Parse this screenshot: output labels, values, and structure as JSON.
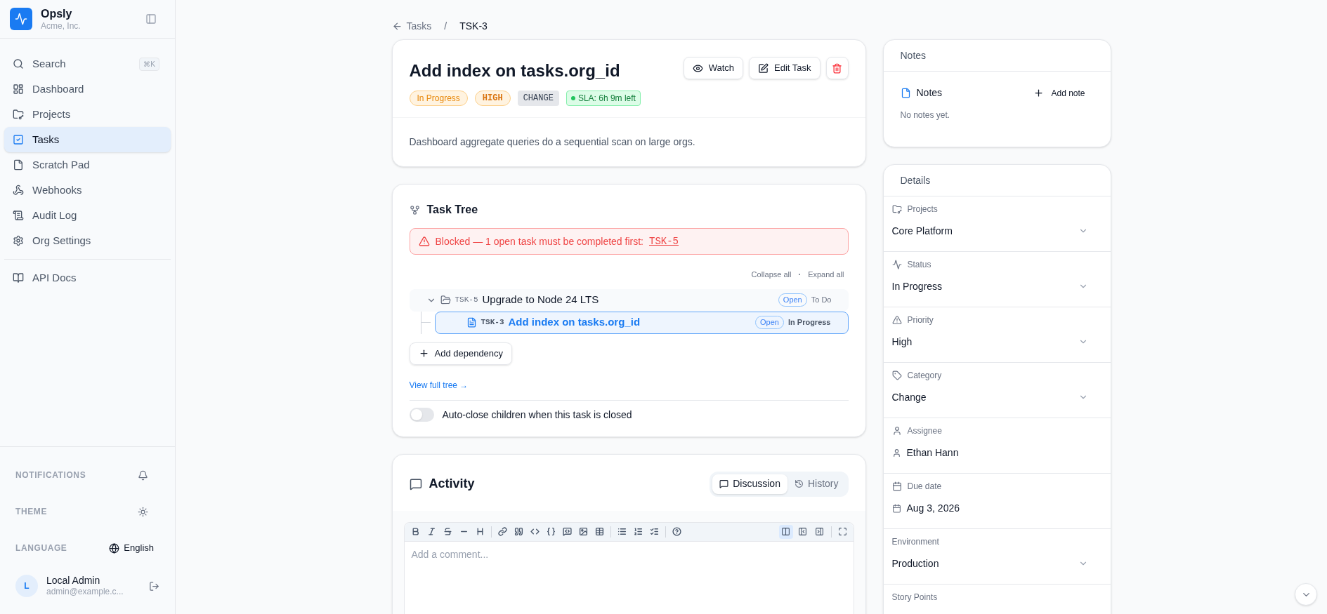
{
  "brand": {
    "name": "Opsly",
    "org": "Acme, Inc."
  },
  "search": {
    "label": "Search",
    "shortcut": "⌘K"
  },
  "nav_groups": [
    {
      "items": [
        {
          "label": "Dashboard",
          "selected": false
        },
        {
          "label": "Projects",
          "selected": false
        },
        {
          "label": "Tasks",
          "selected": true
        },
        {
          "label": "Scratch Pad",
          "selected": false
        },
        {
          "label": "Webhooks",
          "selected": false
        },
        {
          "label": "Audit Log",
          "selected": false
        },
        {
          "label": "Org Settings",
          "selected": false
        }
      ]
    },
    {
      "items": [
        {
          "label": "API Docs",
          "selected": false
        }
      ]
    }
  ],
  "sidebar_footer": {
    "notifications": "NOTIFICATIONS",
    "theme": "THEME",
    "language_label": "LANGUAGE",
    "language": "English",
    "user": {
      "initial": "L",
      "name": "Local Admin",
      "email": "admin@example.c..."
    }
  },
  "breadcrumb": {
    "back": "Tasks",
    "separator": "/",
    "current": "TSK-3"
  },
  "task": {
    "title": "Add index on tasks.org_id",
    "buttons": [
      "Watch",
      "Edit Task"
    ],
    "badges": [
      {
        "kind": "status",
        "label": "In Progress"
      },
      {
        "kind": "priority",
        "label": "HIGH"
      },
      {
        "kind": "category",
        "label": "CHANGE"
      },
      {
        "kind": "sla",
        "label": "SLA: 6h 9m left"
      }
    ],
    "description": "Dashboard aggregate queries do a sequential scan on large orgs."
  },
  "task_tree": {
    "title": "Task Tree",
    "alert": {
      "text": "Blocked — 1 open task must be completed first:",
      "link": "TSK-5"
    },
    "controls": [
      "Collapse all",
      "·",
      "Expand all"
    ],
    "nodes": [
      {
        "id": "TSK-5",
        "title": "Upgrade to Node 24 LTS",
        "badge": "Open",
        "status": "To Do",
        "expanded": true,
        "selected": false,
        "children": [
          {
            "id": "TSK-3",
            "title": "Add index on tasks.org_id",
            "badge": "Open",
            "status": "In Progress",
            "selected": true
          }
        ]
      }
    ],
    "add_button": "Add dependency",
    "view_link": "View full tree →",
    "auto_close": {
      "label": "Auto-close children when this task is closed",
      "on": false
    }
  },
  "activity": {
    "title": "Activity",
    "tabs": [
      {
        "label": "Discussion",
        "selected": true
      },
      {
        "label": "History",
        "selected": false
      }
    ],
    "editor": {
      "placeholder": "Add a comment...",
      "view_modes": [
        {
          "selected": true
        },
        {
          "selected": false
        },
        {
          "selected": false
        }
      ]
    }
  },
  "notes": {
    "header": "Notes",
    "title": "Notes",
    "add": "Add note",
    "empty": "No notes yet."
  },
  "details": {
    "header": "Details",
    "fields": [
      {
        "kind": "select",
        "label": "Projects",
        "value": "Core Platform"
      },
      {
        "kind": "select",
        "label": "Status",
        "value": "In Progress"
      },
      {
        "kind": "select",
        "label": "Priority",
        "value": "High"
      },
      {
        "kind": "select",
        "label": "Category",
        "value": "Change"
      },
      {
        "kind": "person",
        "label": "Assignee",
        "value": "Ethan Hann"
      },
      {
        "kind": "date",
        "label": "Due date",
        "value": "Aug 3, 2026"
      },
      {
        "kind": "select",
        "label": "Environment",
        "value": "Production"
      },
      {
        "kind": "label",
        "label": "Story Points"
      }
    ]
  }
}
